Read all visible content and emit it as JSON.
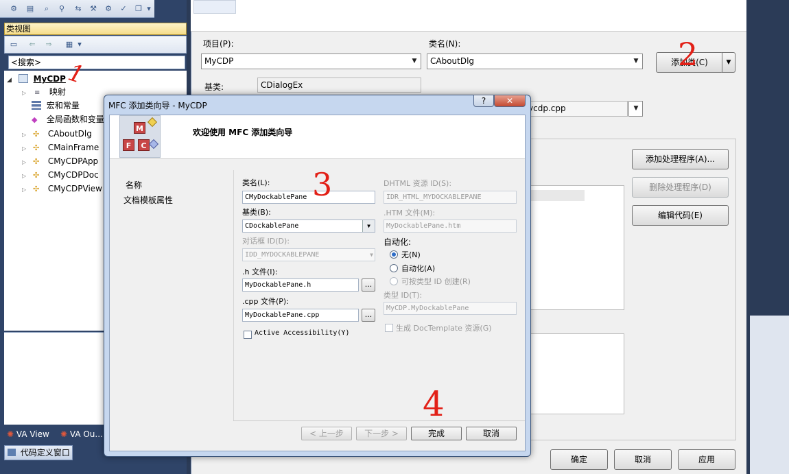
{
  "left": {
    "panel_title": "类视图",
    "search_placeholder": "<搜索>",
    "tree": [
      {
        "label": "MyCDP",
        "icon": "project-icon"
      },
      {
        "label": "映射",
        "icon": "map-icon"
      },
      {
        "label": "宏和常量",
        "icon": "macro-icon"
      },
      {
        "label": "全局函数和变量",
        "icon": "global-icon"
      },
      {
        "label": "CAboutDlg",
        "icon": "class-icon"
      },
      {
        "label": "CMainFrame",
        "icon": "class-icon"
      },
      {
        "label": "CMyCDPApp",
        "icon": "class-icon"
      },
      {
        "label": "CMyCDPDoc",
        "icon": "class-icon"
      },
      {
        "label": "CMyCDPView",
        "icon": "class-icon"
      }
    ],
    "tabs": [
      "VA View",
      "VA Ou..."
    ],
    "code_def_tab": "代码定义窗口"
  },
  "right": {
    "project_label": "项目(P):",
    "project_value": "MyCDP",
    "classname_label": "类名(N):",
    "classname_value": "CAboutDlg",
    "add_class_button": "添加类(C)",
    "base_label": "基类:",
    "base_value": "CDialogEx",
    "file_value": "ycdp.cpp",
    "add_handler_button": "添加处理程序(A)...",
    "remove_handler_button": "删除处理程序(D)",
    "edit_code_button": "编辑代码(E)",
    "ok_button": "确定",
    "cancel_button": "取消",
    "apply_button": "应用"
  },
  "wizard": {
    "title": "MFC 添加类向导 - MyCDP",
    "help_button": "?",
    "close_button": "✕",
    "heading": "欢迎使用 MFC 添加类向导",
    "nav": [
      "名称",
      "文档模板属性"
    ],
    "class_name_label": "类名(L):",
    "class_name_value": "CMyDockablePane",
    "base_class_label": "基类(B):",
    "base_class_value": "CDockablePane",
    "dialog_id_label": "对话框 ID(D):",
    "dialog_id_value": "IDD_MYDOCKABLEPANE",
    "h_file_label": ".h 文件(I):",
    "h_file_value": "MyDockablePane.h",
    "cpp_file_label": ".cpp 文件(P):",
    "cpp_file_value": "MyDockablePane.cpp",
    "browse": "...",
    "active_accessibility": "Active Accessibility(Y)",
    "dhtml_id_label": "DHTML 资源 ID(S):",
    "dhtml_id_value": "IDR_HTML_MYDOCKABLEPANE",
    "htm_file_label": ".HTM 文件(M):",
    "htm_file_value": "MyDockablePane.htm",
    "automation_label": "自动化:",
    "radio_none": "无(N)",
    "radio_automation": "自动化(A)",
    "radio_creatable": "可按类型 ID 创建(R)",
    "type_id_label": "类型 ID(T):",
    "type_id_value": "MyCDP.MyDockablePane",
    "doctemplate_check": "生成 DocTemplate 资源(G)",
    "prev_button": "< 上一步",
    "next_button": "下一步 >",
    "finish_button": "完成",
    "cancel_button": "取消"
  },
  "annotations": [
    "1",
    "2",
    "3",
    "4"
  ]
}
